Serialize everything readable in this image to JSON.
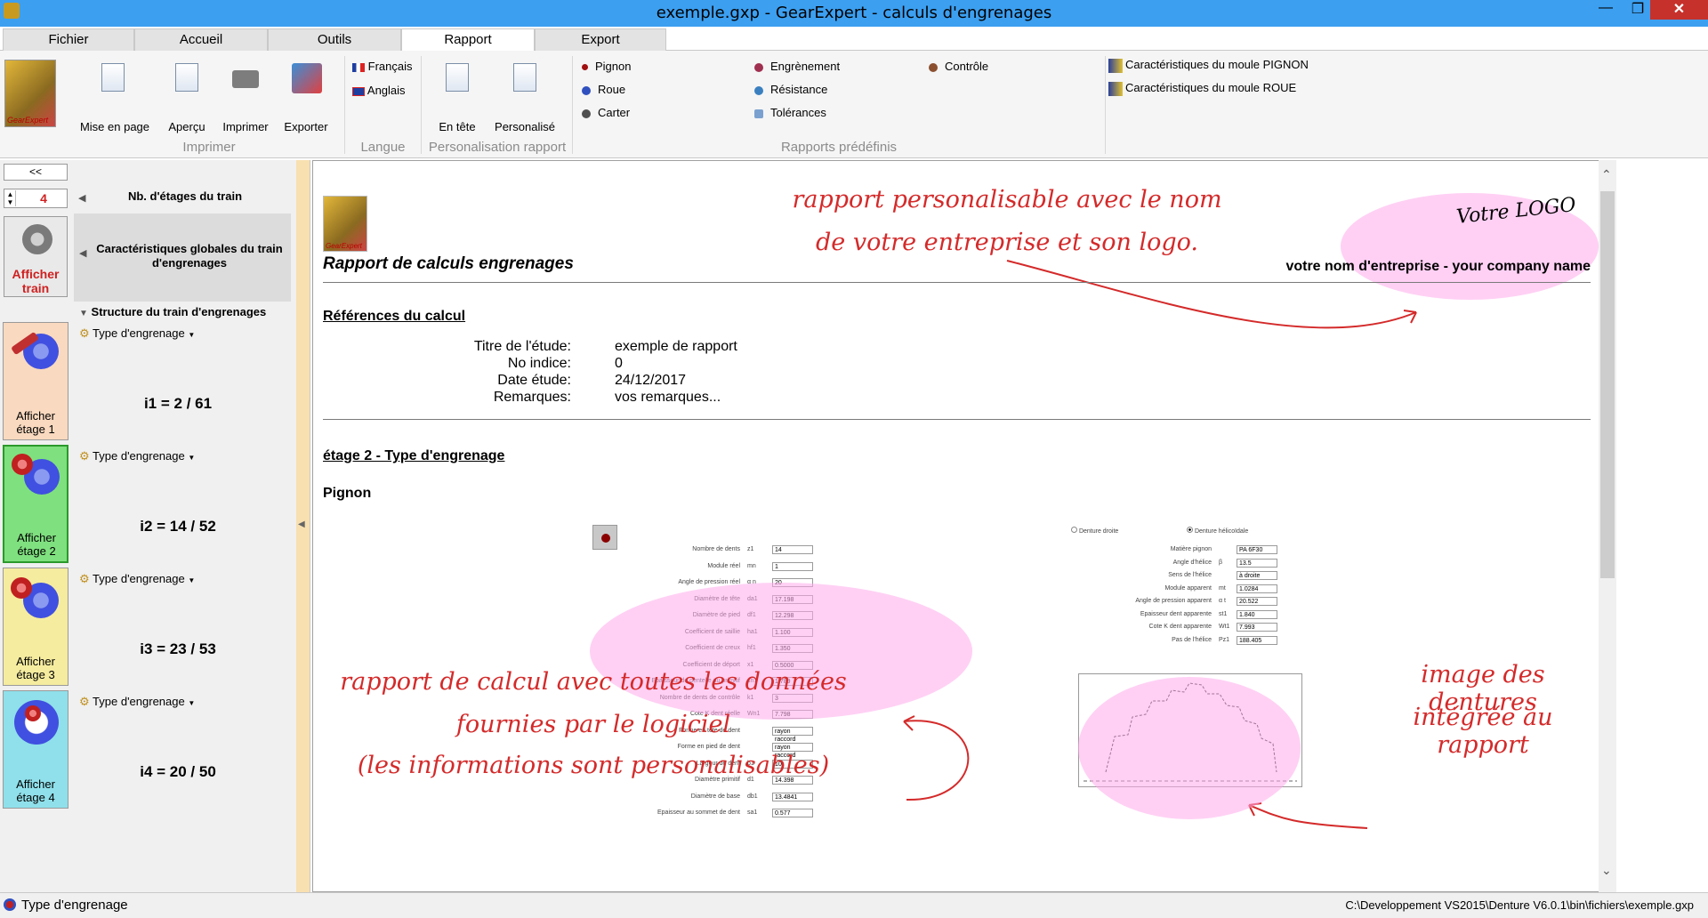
{
  "window": {
    "title": "exemple.gxp - GearExpert - calculs d'engrenages",
    "minimize": "—",
    "maximize": "❐",
    "close": "✕"
  },
  "tabs": [
    "Fichier",
    "Accueil",
    "Outils",
    "Rapport",
    "Export"
  ],
  "active_tab": "Rapport",
  "ribbon": {
    "logo_text": "GearExpert",
    "print_group": {
      "label": "Imprimer",
      "buttons": [
        "Mise en page",
        "Aperçu",
        "Imprimer",
        "Exporter"
      ]
    },
    "lang_group": {
      "label": "Langue",
      "items": [
        "Français",
        "Anglais"
      ]
    },
    "perso_group": {
      "label": "Personalisation rapport",
      "buttons": [
        "En tête",
        "Personalisé"
      ]
    },
    "predefined_group": {
      "label": "Rapports prédéfinis",
      "col1": [
        "Pignon",
        "Roue",
        "Carter"
      ],
      "col2": [
        "Engrènement",
        "Résistance",
        "Tolérances"
      ],
      "col3": [
        "Contrôle"
      ]
    },
    "mould": [
      "Caractéristiques du moule PIGNON",
      "Caractéristiques du moule ROUE"
    ]
  },
  "left": {
    "collapse": "<<",
    "stages_value": "4",
    "stages_label": "Nb. d'étages du train",
    "show_train": "Afficher train",
    "global_label": "Caractéristiques globales du train d'engrenages",
    "structure_label": "Structure du train d'engrenages",
    "stages": [
      {
        "label": "Afficher étage 1",
        "type": "Type d'engrenage",
        "ratio_name": "i1",
        "ratio": "= 2 / 61",
        "color": "#f9d9bf"
      },
      {
        "label": "Afficher étage 2",
        "type": "Type d'engrenage",
        "ratio_name": "i2",
        "ratio": "= 14 / 52",
        "color": "#7fe07f"
      },
      {
        "label": "Afficher étage 3",
        "type": "Type d'engrenage",
        "ratio_name": "i3",
        "ratio": "= 23 / 53",
        "color": "#f5ec9f"
      },
      {
        "label": "Afficher étage 4",
        "type": "Type d'engrenage",
        "ratio_name": "i4",
        "ratio": "= 20 / 50",
        "color": "#8fe0ea"
      }
    ]
  },
  "report": {
    "logo_text": "GearExpert",
    "title": "Rapport de calculs engrenages",
    "company": "votre nom d'entreprise - your company name",
    "logo_placeholder": "Votre LOGO",
    "refs_heading": "Références du calcul",
    "refs": [
      {
        "k": "Titre de l'étude:",
        "v": "exemple de rapport"
      },
      {
        "k": "No indice:",
        "v": "0"
      },
      {
        "k": "Date étude:",
        "v": "24/12/2017"
      },
      {
        "k": "Remarques:",
        "v": "vos remarques..."
      }
    ],
    "stage_heading": "étage 2 - Type d'engrenage",
    "pignon_heading": "Pignon",
    "form_rows": [
      {
        "label": "Nombre de dents",
        "sym": "z1",
        "val": "14"
      },
      {
        "label": "Module réel",
        "sym": "mn",
        "val": "1"
      },
      {
        "label": "Angle de pression réel",
        "sym": "α n",
        "val": "20"
      },
      {
        "label": "Diamètre de tête",
        "sym": "da1",
        "val": "17.198"
      },
      {
        "label": "Diamètre de pied",
        "sym": "df1",
        "val": "12.298"
      },
      {
        "label": "Coefficient de saillie",
        "sym": "ha1",
        "val": "1.100"
      },
      {
        "label": "Coefficient de creux",
        "sym": "hf1",
        "val": "1.350"
      },
      {
        "label": "Coefficient de déport",
        "sym": "x1",
        "val": "0.5000"
      },
      {
        "label": "Epaisseur de dentelle au primitif",
        "sym": "sn1",
        "val": "1.789"
      },
      {
        "label": "Nombre de dents de contrôle",
        "sym": "k1",
        "val": "3"
      },
      {
        "label": "Cote K dent réelle",
        "sym": "Wn1",
        "val": "7.798"
      },
      {
        "label": "Forme en tête de dent",
        "sym": "",
        "val": "rayon raccord"
      },
      {
        "label": "Forme en pied de dent",
        "sym": "",
        "val": "rayon raccord"
      },
      {
        "label": "Largeur de dent",
        "sym": "b1",
        "val": "10"
      },
      {
        "label": "Diamètre primitif",
        "sym": "d1",
        "val": "14.398"
      },
      {
        "label": "Diamètre de base",
        "sym": "db1",
        "val": "13.4841"
      },
      {
        "label": "Epaisseur au sommet de dent",
        "sym": "sa1",
        "val": "0.577"
      }
    ],
    "form_right_rows": [
      {
        "label": "Matière pignon",
        "sym": "",
        "val": "PA 6F30"
      },
      {
        "label": "Angle d'hélice",
        "sym": "β",
        "val": "13.5"
      },
      {
        "label": "Sens de l'hélice",
        "sym": "",
        "val": "à droite"
      },
      {
        "label": "Module apparent",
        "sym": "mt",
        "val": "1.0284"
      },
      {
        "label": "Angle de pression apparent",
        "sym": "α t",
        "val": "20.522"
      },
      {
        "label": "Epaisseur dent apparente",
        "sym": "st1",
        "val": "1.840"
      },
      {
        "label": "Cote K dent apparente",
        "sym": "Wt1",
        "val": "7.993"
      },
      {
        "label": "Pas de l'hélice",
        "sym": "Pz1",
        "val": "188.405"
      }
    ],
    "radio1": "Denture droite",
    "radio2": "Denture hélicoïdale",
    "annot_top_1": "rapport personalisable avec le nom",
    "annot_top_2": "de votre entreprise et son logo.",
    "annot_left_1": "rapport de calcul avec toutes les données",
    "annot_left_2": "fournies par le logiciel",
    "annot_left_3": "(les informations sont personalisables)",
    "annot_right_1": "image des dentures",
    "annot_right_2": "intégrée au rapport"
  },
  "status": {
    "left": "Type d'engrenage",
    "right": "C:\\Developpement VS2015\\Denture V6.0.1\\bin\\fichiers\\exemple.gxp"
  }
}
